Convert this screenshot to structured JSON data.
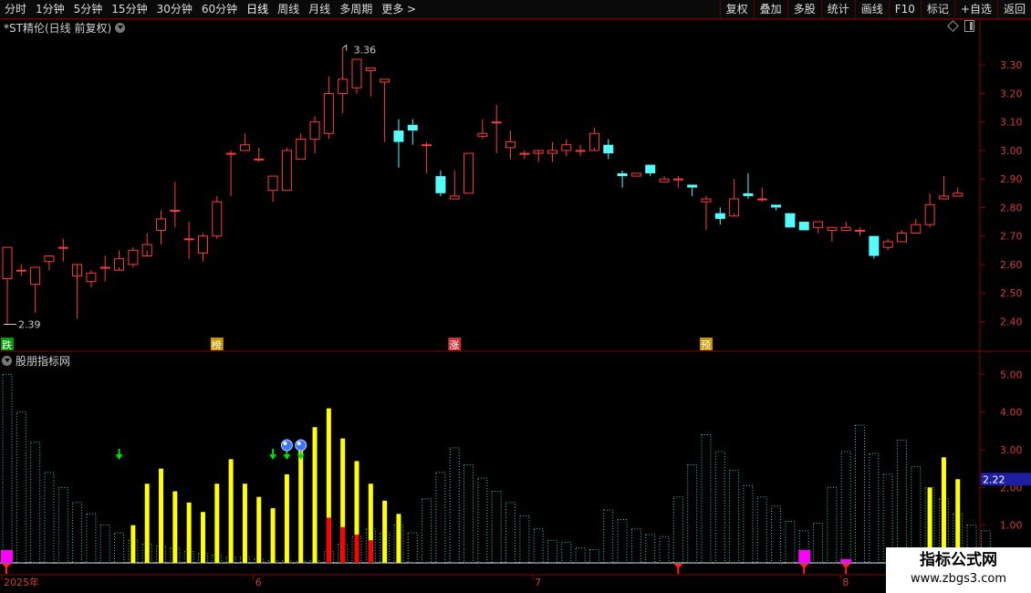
{
  "toolbar": {
    "periods": [
      "分时",
      "1分钟",
      "5分钟",
      "15分钟",
      "30分钟",
      "60分钟",
      "日线",
      "周线",
      "月线",
      "多周期",
      "更多 >"
    ],
    "active": "日线",
    "right": [
      "复权",
      "叠加",
      "多股",
      "统计",
      "画线",
      "F10",
      "标记",
      "+自选",
      "返回"
    ]
  },
  "header": {
    "title": "*ST精伦(日线 前复权)"
  },
  "indicator": {
    "title": "股朋指标网"
  },
  "watermark": {
    "title": "指标公式网",
    "url": "www.zbgs3.com"
  },
  "colors": {
    "up": "#ff3b3b",
    "down": "#54fcfc",
    "yellow": "#ffff00",
    "red": "#ff0000",
    "magenta": "#ff00ff",
    "green": "#00dd00",
    "frame": "#8b0000",
    "axis_text": "#d23c3c"
  },
  "chart_data": [
    {
      "type": "candlestick",
      "title": "*ST精伦(日线 前复权)",
      "ylim": [
        2.35,
        3.4
      ],
      "yticks": [
        2.4,
        2.5,
        2.6,
        2.7,
        2.8,
        2.9,
        3.0,
        3.1,
        3.2,
        3.3
      ],
      "x_labels": [
        {
          "index": 0,
          "label": "2025年"
        },
        {
          "index": 18,
          "label": "6"
        },
        {
          "index": 38,
          "label": "7"
        },
        {
          "index": 60,
          "label": "8"
        }
      ],
      "candles": [
        [
          2.55,
          2.66,
          2.39,
          2.66
        ],
        [
          2.58,
          2.58,
          2.56,
          2.6
        ],
        [
          2.53,
          2.59,
          2.43,
          2.59
        ],
        [
          2.61,
          2.63,
          2.58,
          2.63
        ],
        [
          2.66,
          2.66,
          2.61,
          2.69
        ],
        [
          2.56,
          2.6,
          2.41,
          2.51
        ],
        [
          2.54,
          2.57,
          2.52,
          2.58
        ],
        [
          2.59,
          2.59,
          2.54,
          2.63
        ],
        [
          2.58,
          2.62,
          2.59,
          2.65
        ],
        [
          2.6,
          2.65,
          2.59,
          2.66
        ],
        [
          2.63,
          2.67,
          2.65,
          2.71
        ],
        [
          2.72,
          2.76,
          2.67,
          2.79
        ],
        [
          2.79,
          2.79,
          2.73,
          2.89
        ],
        [
          2.69,
          2.69,
          2.62,
          2.75
        ],
        [
          2.64,
          2.7,
          2.61,
          2.71
        ],
        [
          2.7,
          2.82,
          2.69,
          2.84
        ],
        [
          2.99,
          2.99,
          2.84,
          3.0
        ],
        [
          3.0,
          3.02,
          3.0,
          3.06
        ],
        [
          2.97,
          2.97,
          2.96,
          3.01
        ],
        [
          2.86,
          2.91,
          2.82,
          2.91
        ],
        [
          2.86,
          3.0,
          2.86,
          3.01
        ],
        [
          2.97,
          3.04,
          2.97,
          3.06
        ],
        [
          3.04,
          3.1,
          2.99,
          3.12
        ],
        [
          3.06,
          3.2,
          3.04,
          3.26
        ],
        [
          3.2,
          3.25,
          3.13,
          3.36
        ],
        [
          3.22,
          3.32,
          3.2,
          3.32
        ],
        [
          3.28,
          3.29,
          3.19,
          3.29
        ],
        [
          3.24,
          3.25,
          3.03,
          3.25
        ],
        [
          3.07,
          3.03,
          2.94,
          3.11
        ],
        [
          3.09,
          3.07,
          3.02,
          3.11
        ],
        [
          3.02,
          3.02,
          2.92,
          3.03
        ],
        [
          2.91,
          2.85,
          2.84,
          2.93
        ],
        [
          2.83,
          2.84,
          2.83,
          2.93
        ],
        [
          2.85,
          2.99,
          2.85,
          2.99
        ],
        [
          3.05,
          3.06,
          3.04,
          3.11
        ],
        [
          3.1,
          3.1,
          2.99,
          3.16
        ],
        [
          3.01,
          3.03,
          2.97,
          3.07
        ],
        [
          2.99,
          2.99,
          2.97,
          3.0
        ],
        [
          2.99,
          3.0,
          2.99,
          2.96
        ],
        [
          2.99,
          3.0,
          2.96,
          3.03
        ],
        [
          3.0,
          3.02,
          2.98,
          3.04
        ],
        [
          3.0,
          3.0,
          2.98,
          3.02
        ],
        [
          3.0,
          3.06,
          3.01,
          3.08
        ],
        [
          3.02,
          2.99,
          2.97,
          3.04
        ],
        [
          2.92,
          2.91,
          2.87,
          2.93
        ],
        [
          2.91,
          2.92,
          2.91,
          2.92
        ],
        [
          2.95,
          2.92,
          2.91,
          2.95
        ],
        [
          2.89,
          2.9,
          2.89,
          2.91
        ],
        [
          2.9,
          2.9,
          2.87,
          2.91
        ],
        [
          2.88,
          2.87,
          2.84,
          2.88
        ],
        [
          2.82,
          2.83,
          2.72,
          2.84
        ],
        [
          2.78,
          2.76,
          2.74,
          2.8
        ],
        [
          2.77,
          2.83,
          2.78,
          2.9
        ],
        [
          2.85,
          2.84,
          2.83,
          2.92
        ],
        [
          2.83,
          2.83,
          2.82,
          2.87
        ],
        [
          2.81,
          2.8,
          2.79,
          2.81
        ],
        [
          2.78,
          2.73,
          2.74,
          2.78
        ],
        [
          2.75,
          2.72,
          2.72,
          2.75
        ],
        [
          2.73,
          2.75,
          2.71,
          2.75
        ],
        [
          2.72,
          2.73,
          2.68,
          2.73
        ],
        [
          2.72,
          2.73,
          2.72,
          2.75
        ],
        [
          2.72,
          2.72,
          2.7,
          2.73
        ],
        [
          2.7,
          2.63,
          2.62,
          2.7
        ],
        [
          2.66,
          2.68,
          2.65,
          2.69
        ],
        [
          2.68,
          2.71,
          2.68,
          2.72
        ],
        [
          2.71,
          2.74,
          2.71,
          2.76
        ],
        [
          2.74,
          2.81,
          2.73,
          2.85
        ],
        [
          2.83,
          2.84,
          2.83,
          2.91
        ],
        [
          2.84,
          2.85,
          2.84,
          2.87
        ]
      ],
      "annotations": [
        {
          "text": "3.36",
          "index": 24,
          "value": 3.36
        },
        {
          "text": "2.39",
          "index": 0,
          "value": 2.39
        }
      ],
      "tags": [
        {
          "text": "跌",
          "index": 0
        },
        {
          "text": "榜",
          "index": 15
        },
        {
          "text": "涨",
          "index": 32
        },
        {
          "text": "预",
          "index": 50
        }
      ]
    },
    {
      "type": "bar",
      "title": "股朋指标网",
      "ylim": [
        0,
        5.3
      ],
      "yticks": [
        1.0,
        2.0,
        3.0,
        4.0,
        5.0
      ],
      "current_value_label": "2.22",
      "current_value": 2.22,
      "series": [
        {
          "style": "cyan-dotted",
          "values": [
            5.0,
            4.0,
            3.2,
            2.4,
            2.0,
            1.6,
            1.3,
            1.0,
            0.8,
            0.6,
            0.5,
            0.45,
            0.4,
            0.3,
            0.25,
            0.2,
            0.15,
            0.15,
            0.1,
            0.05,
            0.05,
            0.04,
            0.05,
            0.3,
            0.5,
            0.7,
            0.9,
            0.8,
            1.0,
            0.8,
            1.7,
            2.4,
            3.05,
            2.6,
            2.25,
            1.9,
            1.6,
            1.25,
            0.9,
            0.6,
            0.55,
            0.4,
            0.35,
            1.4,
            1.15,
            0.9,
            0.75,
            0.7,
            1.75,
            2.6,
            3.4,
            2.95,
            2.45,
            2.05,
            1.75,
            1.5,
            1.1,
            0.85,
            1.05,
            2.0,
            2.95,
            3.65,
            2.9,
            2.35,
            3.25,
            2.55,
            2.0,
            1.7,
            1.3,
            1.0,
            0.85
          ]
        },
        {
          "style": "yellow",
          "values": [
            0,
            0,
            0,
            0,
            0,
            0,
            0,
            0,
            0,
            1.0,
            2.1,
            2.5,
            1.9,
            1.6,
            1.35,
            2.1,
            2.75,
            2.1,
            1.75,
            1.45,
            2.35,
            3.0,
            3.6,
            4.1,
            3.3,
            2.7,
            2.1,
            1.65,
            1.3,
            0,
            0,
            0,
            0,
            0,
            0,
            0,
            0,
            0,
            0,
            0,
            0,
            0,
            0,
            0,
            0,
            0,
            0,
            0,
            0,
            0,
            0,
            0,
            0,
            0,
            0,
            0,
            0,
            0,
            0,
            0,
            0,
            0,
            0,
            0,
            0,
            0,
            2.0,
            2.8,
            2.22
          ]
        },
        {
          "style": "red",
          "values": [
            0,
            0,
            0,
            0,
            0,
            0,
            0,
            0,
            0,
            0,
            0,
            0,
            0,
            0,
            0,
            0,
            0,
            0,
            0,
            0,
            0,
            0,
            0,
            1.2,
            0.95,
            0.75,
            0.6,
            0,
            0,
            0,
            0,
            0,
            0,
            0,
            0,
            0,
            0,
            0,
            0,
            0,
            0,
            0,
            0,
            0,
            0,
            0,
            0,
            0,
            0,
            0,
            0,
            0,
            0,
            0,
            0,
            0,
            0,
            0,
            0,
            0,
            0,
            0,
            0,
            0,
            0,
            0,
            0,
            0,
            0
          ]
        }
      ],
      "markers": [
        {
          "kind": "green-arrow",
          "index": 8
        },
        {
          "kind": "green-arrow",
          "index": 19
        },
        {
          "kind": "green-arrow",
          "index": 20
        },
        {
          "kind": "green-arrow",
          "index": 21
        },
        {
          "kind": "ball",
          "index": 20
        },
        {
          "kind": "ball",
          "index": 21
        },
        {
          "kind": "magenta-square",
          "index": -1
        },
        {
          "kind": "magenta-square",
          "index": 57
        },
        {
          "kind": "magenta-square-small",
          "index": 60
        },
        {
          "kind": "red-pin",
          "index": -1
        },
        {
          "kind": "red-pin",
          "index": 48
        },
        {
          "kind": "red-pin",
          "index": 57
        },
        {
          "kind": "red-pin",
          "index": 60
        }
      ]
    }
  ]
}
